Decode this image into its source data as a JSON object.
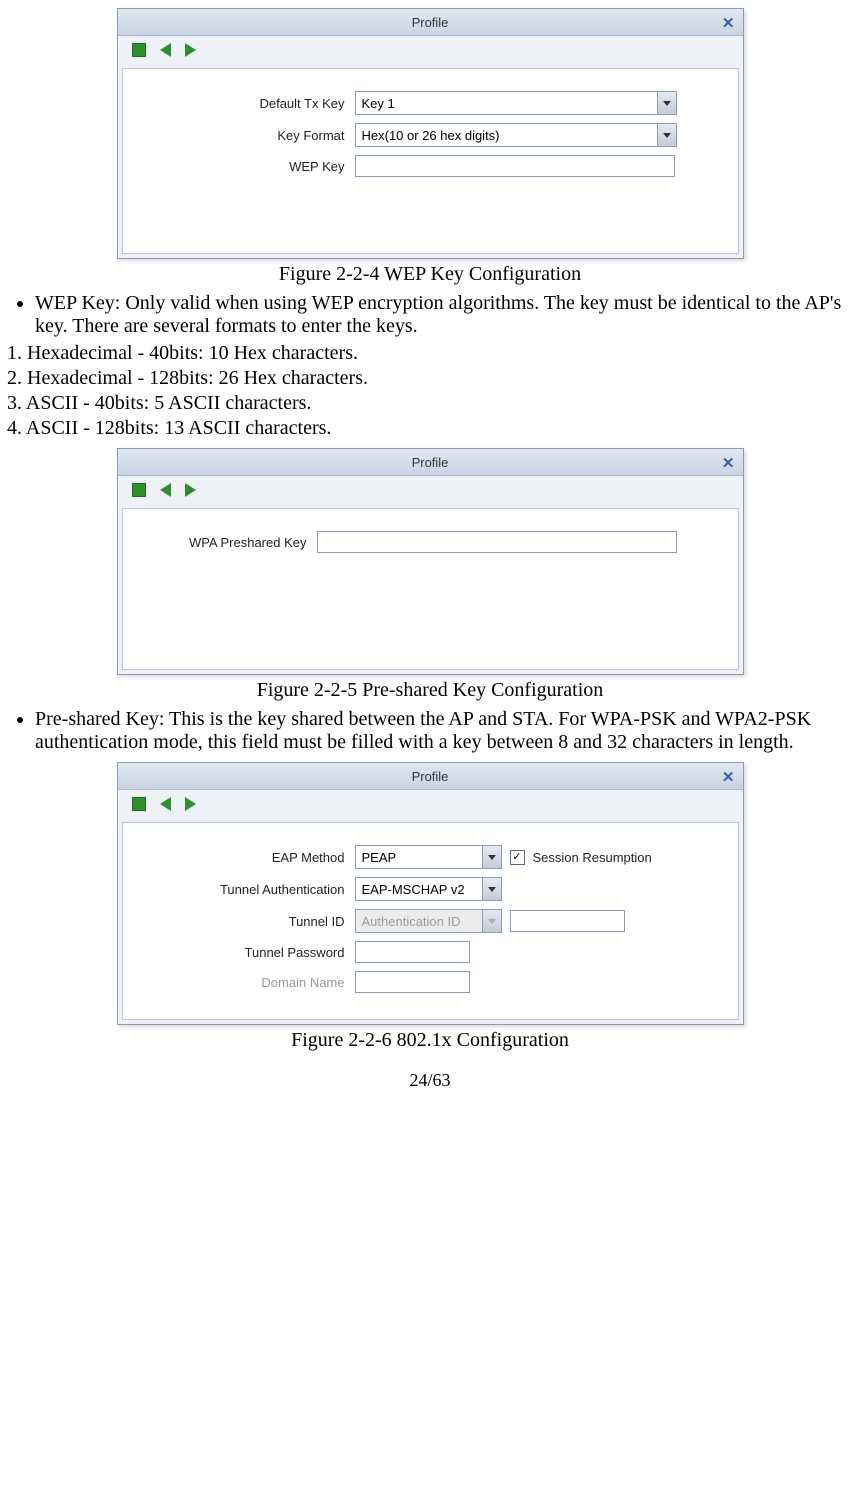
{
  "win": {
    "title": "Profile",
    "close": "✕"
  },
  "fig1": {
    "caption": "Figure 2-2-4 WEP Key Configuration",
    "rows": {
      "default_tx_key_label": "Default Tx Key",
      "default_tx_key_value": "Key 1",
      "key_format_label": "Key Format",
      "key_format_value": "Hex(10 or 26 hex digits)",
      "wep_key_label": "WEP Key",
      "wep_key_value": ""
    }
  },
  "text1": {
    "bullet": "WEP Key: Only valid when using WEP encryption algorithms. The key must be identical to the AP's key. There are several formats to enter the keys.",
    "l1": "1. Hexadecimal - 40bits: 10 Hex characters.",
    "l2": "2. Hexadecimal - 128bits: 26 Hex characters.",
    "l3": "3. ASCII - 40bits: 5 ASCII characters.",
    "l4": "4. ASCII - 128bits: 13 ASCII characters."
  },
  "fig2": {
    "caption": "Figure 2-2-5 Pre-shared Key Configuration",
    "rows": {
      "psk_label": "WPA Preshared Key",
      "psk_value": ""
    }
  },
  "text2": {
    "bullet": "Pre-shared Key: This is the key shared between the AP and STA. For WPA-PSK and WPA2-PSK authentication mode, this field must be filled with a key between 8 and 32 characters in length."
  },
  "fig3": {
    "caption": "Figure 2-2-6 802.1x Configuration",
    "rows": {
      "eap_label": "EAP Method",
      "eap_value": "PEAP",
      "session_resumption_label": "Session Resumption",
      "session_resumption_checked": "✓",
      "tunnel_auth_label": "Tunnel Authentication",
      "tunnel_auth_value": "EAP-MSCHAP v2",
      "tunnel_id_label": "Tunnel ID",
      "tunnel_id_select_value": "Authentication ID",
      "tunnel_id_text_value": "",
      "tunnel_pw_label": "Tunnel Password",
      "tunnel_pw_value": "",
      "domain_label": "Domain Name",
      "domain_value": ""
    }
  },
  "pagenum": "24/63"
}
